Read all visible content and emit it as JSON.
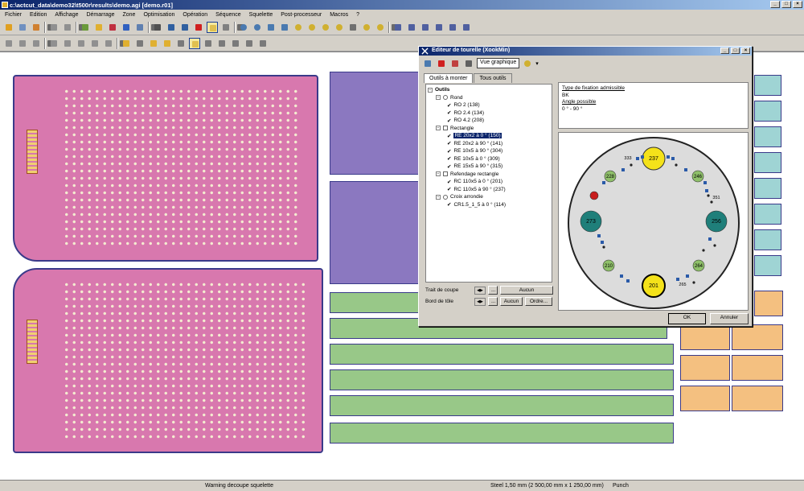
{
  "window": {
    "title": "c:\\actcut_data\\demo32\\t500r\\results\\demo.agi [demo.r01]"
  },
  "menu": [
    "Fichier",
    "Edition",
    "Affichage",
    "Démarrage",
    "Zone",
    "Optimisation",
    "Opération",
    "Séquence",
    "Squelette",
    "Post-processeur",
    "Macros",
    "?"
  ],
  "dialog": {
    "title": "Editeur de tourelle (XookMin)",
    "view_button": "Vue graphique",
    "tabs": [
      "Outils à monter",
      "Tous outils"
    ],
    "tree": {
      "root": "Outils",
      "groups": [
        {
          "label": "Rond",
          "items": [
            "RO 2 (138)",
            "RO 2.4 (134)",
            "RO 4.2 (208)"
          ]
        },
        {
          "label": "Rectangle",
          "items": [
            "RE 20x2 à 0 ° (150)",
            "RE 20x2 à 90 ° (141)",
            "RE 10x5 à 90 ° (304)",
            "RE 10x5 à 0 ° (309)",
            "RE 15x5 à 90 ° (315)"
          ]
        },
        {
          "label": "Refendage rectangle",
          "items": [
            "RC 110x5 à 0 ° (201)",
            "RC 110x5 à 90 ° (237)"
          ]
        },
        {
          "label": "Croix arrondie",
          "items": [
            "CR1.5_1_5 à 0 ° (114)"
          ]
        }
      ],
      "selected": "RE 20x2 à 0 ° (150)"
    },
    "trait_de_coupe": {
      "label": "Trait de coupe",
      "button": "Aucun"
    },
    "bord_de_tole": {
      "label": "Bord de tôle",
      "button": "Aucun",
      "order_button": "Ordre...",
      "ellipsis": "..."
    },
    "info": {
      "type_label": "Type de fixation admissible",
      "type_value": "BK",
      "angle_label": "Angle possible",
      "angle_value": "0 ° - 90 °"
    },
    "turret": {
      "stations": [
        "237",
        "228",
        "246",
        "273",
        "256",
        "210",
        "264",
        "201",
        "333",
        "351",
        "265"
      ],
      "colors": {
        "yellow": "#f4e21a",
        "green": "#8fc06a",
        "teal": "#1f7f7a",
        "red": "#c81e1e"
      }
    },
    "ok_label": "OK",
    "cancel_label": "Annuler"
  },
  "status": {
    "warning": "Warning decoupe squelette",
    "material": "Steel 1,50 mm (2 500,00 mm x 1 250,00 mm)",
    "mode": "Punch"
  }
}
